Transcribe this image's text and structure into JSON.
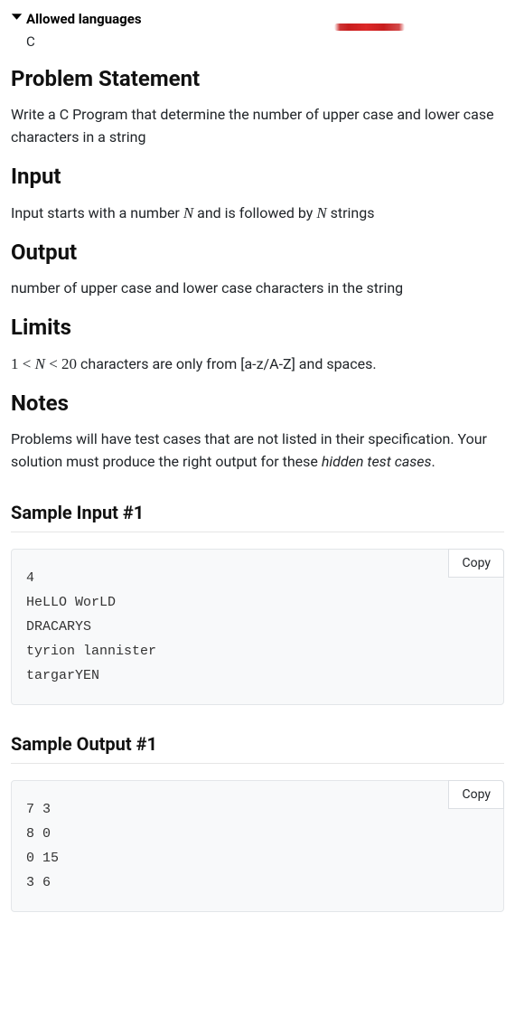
{
  "allowed": {
    "label": "Allowed languages",
    "language": "C"
  },
  "headings": {
    "problem_statement": "Problem Statement",
    "input": "Input",
    "output": "Output",
    "limits": "Limits",
    "notes": "Notes",
    "sample_input_1": "Sample Input #1",
    "sample_output_1": "Sample Output #1"
  },
  "text": {
    "problem_statement": "Write a C Program that determine the number of upper case and lower case characters in a string",
    "input_pre": "Input starts with a number ",
    "input_var1": "N",
    "input_mid": " and is followed by ",
    "input_var2": "N",
    "input_post": " strings",
    "output": "number of upper case and lower case characters in the string",
    "limits_pre": "1 < ",
    "limits_var": "N",
    "limits_mid": " < 20",
    "limits_post": " characters are only from [a-z/A-Z] and spaces.",
    "notes_pre": "Problems will have test cases that are not listed in their specification. Your solution must produce the right output for these ",
    "notes_em": "hidden test cases",
    "notes_post": "."
  },
  "buttons": {
    "copy": "Copy"
  },
  "sample_input_1": "4\nHeLLO WorLD\nDRACARYS\ntyrion lannister\ntargarYEN",
  "sample_output_1": "7 3\n8 0\n0 15\n3 6"
}
